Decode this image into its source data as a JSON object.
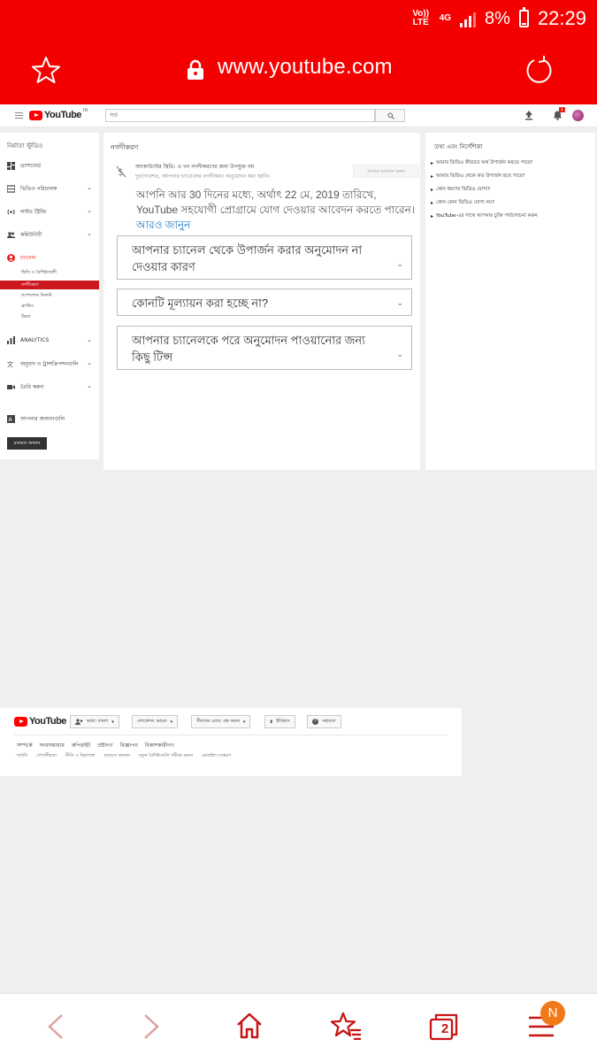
{
  "status": {
    "volte": "Vo)) LTE",
    "network": "4G",
    "battery": "8%",
    "time": "22:29"
  },
  "browser": {
    "url": "www.youtube.com",
    "tab_count": "2",
    "menu_badge": "N"
  },
  "header": {
    "logo": "YouTube",
    "region": "IN",
    "search_placeholder": "সার্চ",
    "notification_count": "1"
  },
  "sidebar": {
    "title": "নির্মাতা স্টুডিও",
    "items": [
      {
        "label": "ড্যাশবোর্ড"
      },
      {
        "label": "ভিডিও পরিচালক"
      },
      {
        "label": "লাইভ স্ট্রিমিং"
      },
      {
        "label": "কমিউনিটি"
      },
      {
        "label": "চ্যানেল"
      }
    ],
    "channel_sub": [
      {
        "label": "স্থিতি ও বৈশিষ্ট্যাবলী"
      },
      {
        "label": "নগদীকরণ"
      },
      {
        "label": "আপলোড ডিফল্ট"
      },
      {
        "label": "ব্র্যান্ডিং"
      },
      {
        "label": "উন্নত"
      }
    ],
    "items2": [
      {
        "label": "ANALYTICS"
      },
      {
        "label": "অনুবাদ ও ট্রান্সক্রিপশনগুলি"
      },
      {
        "label": "তৈরি করুন"
      },
      {
        "label": "আপনার অবদানগুলি"
      }
    ],
    "feedback": "মতামত জানান"
  },
  "main": {
    "title": "নগদীকরণ",
    "status_line": "অ্যাকাউন্টের স্থিতি: এ খন নগদীকরণের জন্য উপযুক্ত নয়",
    "status_sub": "দুর্ভাগ্যবশত, আপনার চ্যানেলের নগদীকরণ অনুমোদন করা হয়নি।",
    "apply_again": "আবার আবেদন করুন",
    "apply_text": "আপনি আর 30 দিনের মধ্যে, অর্থাৎ 22 মে, 2019 তারিখে, YouTube সহযোগী প্রোগ্রামে যোগ দেওয়ার আবেদন করতে পারেন।",
    "learn_more": "আরও জানুন",
    "accordions": [
      {
        "label": "আপনার চ্যানেল থেকে উপার্জন করার অনুমোদন না দেওয়ার কারণ"
      },
      {
        "label": "কোনটি মূল্যায়ন করা হচ্ছে না?"
      },
      {
        "label": "আপনার চ্যানেলকে পরে অনুমোদন পাওয়ানোর জন্য কিছু টিপ্স"
      }
    ]
  },
  "help": {
    "title": "তথ্য এবং নির্দেশিকা",
    "links": [
      "আমার ভিডিও কীভাবে অর্থ উপার্জন করতে পারে?",
      "আমার ভিডিও থেকে কত উপার্জন হতে পারে?",
      "কোন ধরণের ভিডিও যোগ্য?",
      "কোন কোন ভিডিও যোগ্য নয়?",
      "YouTube-এর সাথে আপনার চুক্তি পর্যালোচনা করুন"
    ]
  },
  "footer": {
    "logo": "YouTube",
    "language": "ভাষা: বাংলা",
    "location": "লোকেশন: ভারত",
    "restricted": "সীমাবদ্ধ মোড: বন্ধ করুন",
    "history": "ইতিহাস",
    "help": "সহায়তা",
    "links1": [
      "সম্পর্কে",
      "সংবাদমাধ্যম",
      "কপিরাইট",
      "স্রষ্টাগণ",
      "বিজ্ঞাপন",
      "বিকাশকারীগণ"
    ],
    "links2": [
      "শর্তাদি",
      "গোপনীয়তা",
      "নীতি ও নিরাপত্তা",
      "মতামত জানান",
      "নতুন বৈশিষ্ট্যগুলি পরীক্ষা করুন",
      "মোবাইল সংস্করণ"
    ]
  },
  "colors": {
    "browser_red": "#f50000",
    "yt_red": "#cc181e",
    "link_blue": "#167ac6",
    "badge_orange": "#f07a1a"
  }
}
